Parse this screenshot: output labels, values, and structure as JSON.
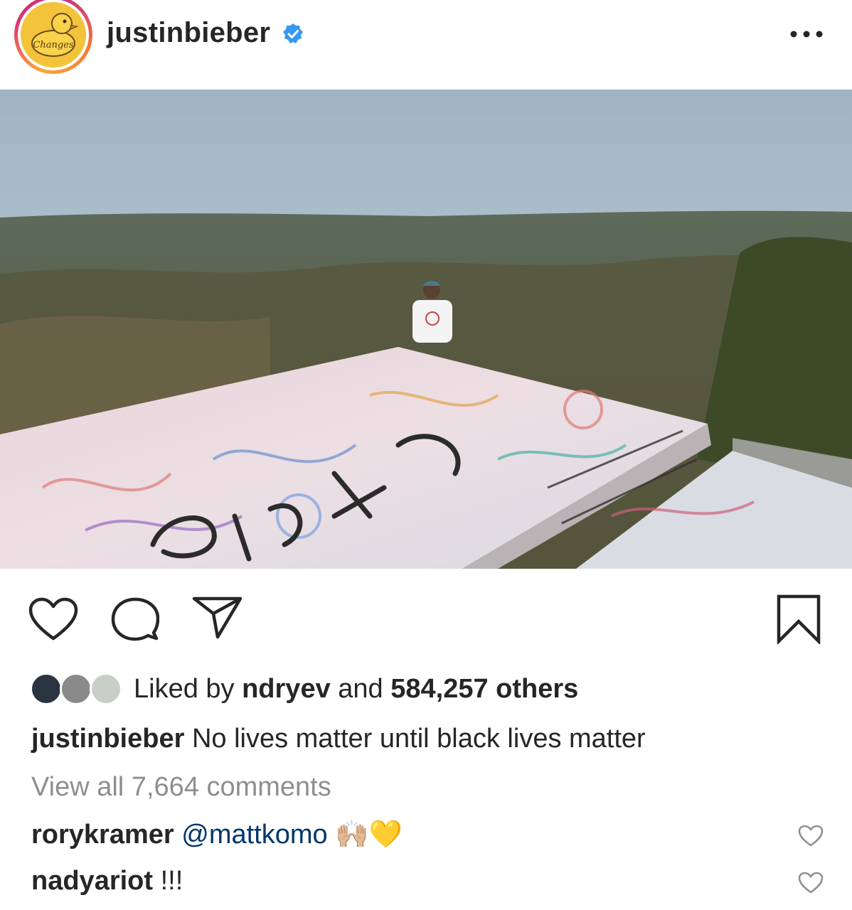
{
  "post": {
    "username": "justinbieber",
    "avatar_text": "Changes",
    "verified": true
  },
  "actions": {
    "like_icon": "heart-outline-icon",
    "comment_icon": "comment-bubble-icon",
    "share_icon": "paper-plane-icon",
    "save_icon": "bookmark-icon"
  },
  "likes": {
    "prefix": "Liked by ",
    "user": "ndryev",
    "middle": " and ",
    "count": "584,257 others"
  },
  "caption": {
    "username": "justinbieber",
    "text": "No lives matter until black lives matter"
  },
  "view_all": "View all 7,664 comments",
  "comments": [
    {
      "username": "rorykramer",
      "mention": "@mattkomo",
      "text": " 🙌🏼💛"
    },
    {
      "username": "nadyariot",
      "mention": "",
      "text": "!!!"
    }
  ],
  "colors": {
    "verified": "#3897f0",
    "mention": "#00376b",
    "muted": "#8e8e8e"
  }
}
